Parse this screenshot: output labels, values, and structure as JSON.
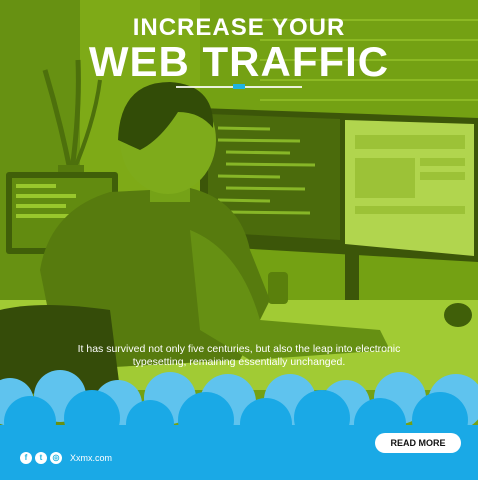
{
  "headline": {
    "line1": "INCREASE YOUR",
    "line2": "WEB TRAFFIC"
  },
  "body_text": "It has survived not only five centuries, but also the leap into electronic typesetting, remaining essentially unchanged.",
  "cta": {
    "label": "READ MORE"
  },
  "footer": {
    "social": [
      {
        "icon": "facebook-icon",
        "glyph": "f"
      },
      {
        "icon": "twitter-icon",
        "glyph": "t"
      },
      {
        "icon": "instagram-icon",
        "glyph": "◎"
      }
    ],
    "website": "Xxmx.com"
  },
  "colors": {
    "accent": "#1fb3e0",
    "overlay": "#8fc21a",
    "cloud": "#1aa9e6"
  }
}
